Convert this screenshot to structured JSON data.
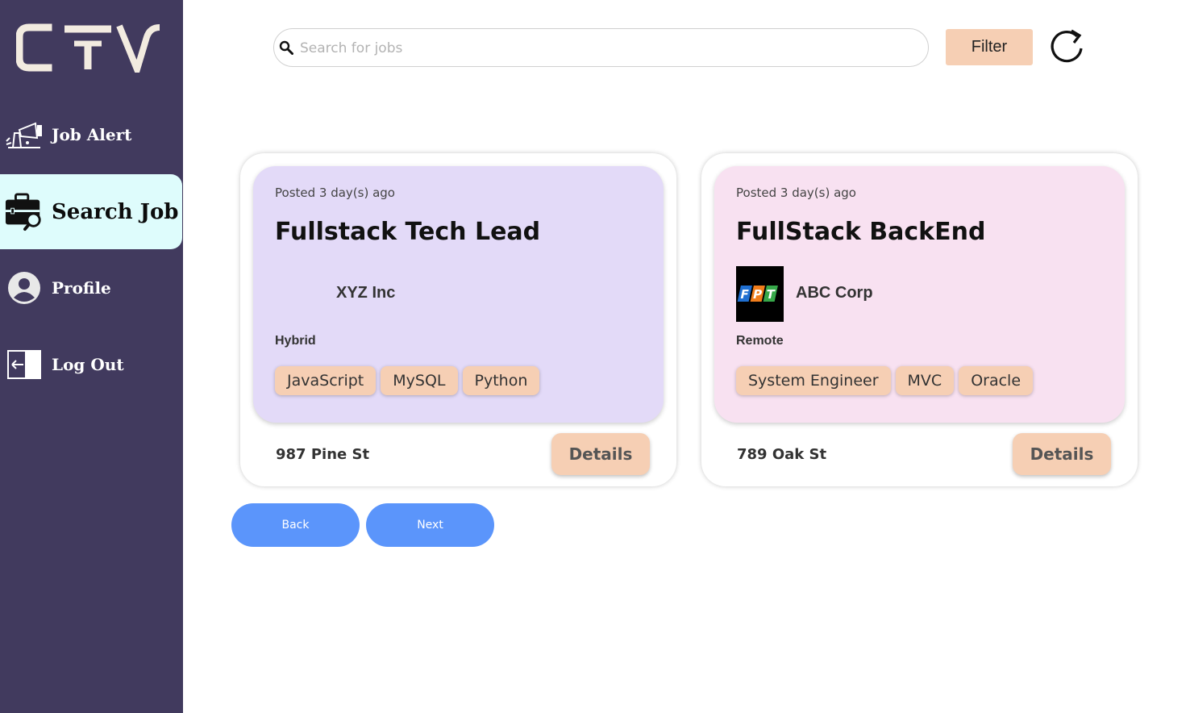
{
  "brand": {
    "logo_text": "CTV"
  },
  "sidebar": {
    "items": [
      {
        "label": "Job Alert",
        "icon": "megaphone-icon"
      },
      {
        "label": "Search Job",
        "icon": "briefcase-search-icon",
        "active": true
      },
      {
        "label": "Profile",
        "icon": "user-avatar-icon"
      },
      {
        "label": "Log Out",
        "icon": "logout-arrow-icon"
      }
    ]
  },
  "search": {
    "placeholder": "Search for jobs",
    "value": ""
  },
  "toolbar": {
    "filter_label": "Filter",
    "refresh_icon": "refresh-icon"
  },
  "jobs": [
    {
      "posted": "Posted 3 day(s) ago",
      "title": "Fullstack Tech Lead",
      "company": "XYZ Inc",
      "work_mode": "Hybrid",
      "tags": [
        "JavaScript",
        "MySQL",
        "Python"
      ],
      "address": "987 Pine St",
      "details_label": "Details",
      "card_color": "#e3daf8"
    },
    {
      "posted": "Posted 3 day(s) ago",
      "title": "FullStack BackEnd",
      "company": "ABC Corp",
      "company_logo": {
        "letters": [
          "F",
          "P",
          "T"
        ]
      },
      "work_mode": "Remote",
      "tags": [
        "System Engineer",
        "MVC",
        "Oracle"
      ],
      "address": "789 Oak St",
      "details_label": "Details",
      "card_color": "#f8e1f1"
    }
  ],
  "pagination": {
    "back_label": "Back",
    "next_label": "Next"
  },
  "colors": {
    "sidebar_bg": "#413a5e",
    "active_nav_bg": "#defcfc",
    "accent_peach": "#f6cfb4",
    "button_blue": "#5b95fb"
  }
}
